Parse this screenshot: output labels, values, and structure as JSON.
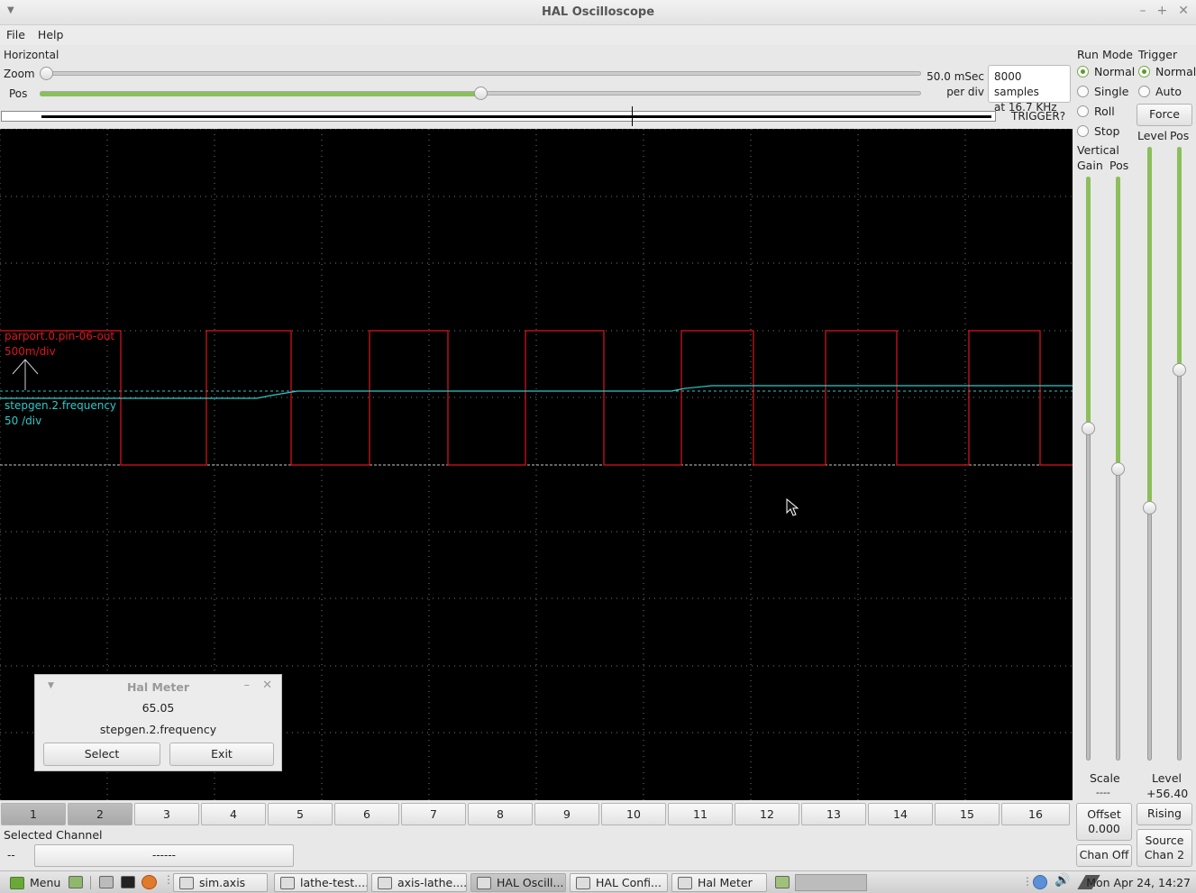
{
  "window": {
    "title": "HAL Oscilloscope"
  },
  "menu": {
    "file": "File",
    "help": "Help"
  },
  "horizontal": {
    "title": "Horizontal",
    "zoom_label": "Zoom",
    "pos_label": "Pos",
    "zoom_value": 0.0,
    "pos_value": 0.5,
    "time_per_div": "50.0 mSec",
    "per_div": "per div",
    "samples": "8000 samples",
    "rate": "at 16.7 KHz"
  },
  "run_mode": {
    "title": "Run Mode",
    "options": [
      "Normal",
      "Single",
      "Roll",
      "Stop"
    ],
    "selected": "Normal"
  },
  "trigger": {
    "title": "Trigger",
    "options": [
      "Normal",
      "Auto"
    ],
    "selected": "Normal",
    "force_label": "Force",
    "status": "TRIGGER?",
    "level_label": "Level",
    "pos_label": "Pos",
    "level_caption": "Level",
    "level_value": "+56.40",
    "edge_label": "Rising",
    "source_label": "Source",
    "source_value": "Chan  2",
    "level_slider": 0.41,
    "pos_slider": 0.64
  },
  "vertical": {
    "title": "Vertical",
    "gain_label": "Gain",
    "pos_label": "Pos",
    "scale_label": "Scale",
    "scale_value": "----",
    "offset_label": "Offset",
    "offset_value": "0.000",
    "chan_off_label": "Chan Off",
    "gain_slider": 0.57,
    "pos_slider": 0.5
  },
  "scope": {
    "channels": [
      {
        "name": "parport.0.pin-06-out",
        "scale": "500m/div",
        "color": "#e0141e"
      },
      {
        "name": "stepgen.2.frequency",
        "scale": "50 /div",
        "color": "#2ec9c9"
      }
    ]
  },
  "channel_bar": {
    "buttons": [
      "1",
      "2",
      "3",
      "4",
      "5",
      "6",
      "7",
      "8",
      "9",
      "10",
      "11",
      "12",
      "13",
      "14",
      "15",
      "16"
    ],
    "active": [
      "1",
      "2"
    ],
    "selected_label": "Selected Channel",
    "selected_dash": "--",
    "selected_value": "------"
  },
  "meter": {
    "title": "Hal Meter",
    "value": "65.05",
    "pin": "stepgen.2.frequency",
    "select_label": "Select",
    "exit_label": "Exit"
  },
  "taskbar": {
    "menu_label": "Menu",
    "items": [
      "sim.axis",
      "lathe-test....",
      "axis-lathe....",
      "HAL Oscill...",
      "HAL Confi...",
      "Hal Meter"
    ],
    "active_item": "HAL Oscill...",
    "clock": "Mon Apr 24, 14:27"
  },
  "colors": {
    "accent": "#8bbf5a",
    "scope_bg": "#000000"
  }
}
